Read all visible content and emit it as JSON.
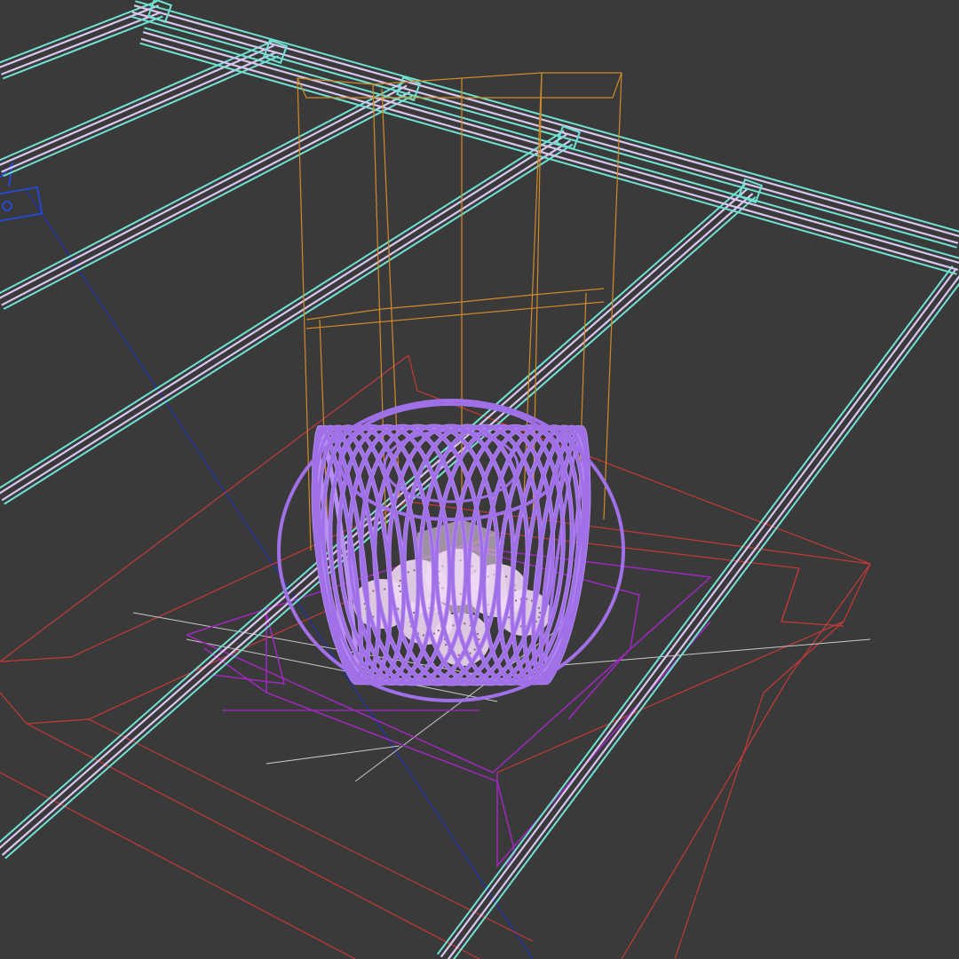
{
  "viewport": {
    "mode": "wireframe",
    "background_color": "#3a3a3a"
  },
  "colors": {
    "rail_outline": "#6fe3d2",
    "rail_highlight": "#d8c8f0",
    "lamp_frame": "#d08a2a",
    "torus": "#a070e8",
    "torus_light": "#b890f2",
    "bulb": "#f0d8f4",
    "floor_box": "#c83838",
    "platform": "#a028c0",
    "grid": "#c8c8c8",
    "axis": "#2030b0"
  },
  "objects": [
    {
      "name": "ceiling-rails",
      "color_key": "rail_outline"
    },
    {
      "name": "pendant-lamp-frame",
      "color_key": "lamp_frame"
    },
    {
      "name": "torus-lamp-shade",
      "color_key": "torus"
    },
    {
      "name": "bulb-cluster",
      "color_key": "bulb"
    },
    {
      "name": "floor-block",
      "color_key": "floor_box"
    },
    {
      "name": "platform",
      "color_key": "platform"
    },
    {
      "name": "gizmo",
      "color_key": "axis"
    }
  ]
}
